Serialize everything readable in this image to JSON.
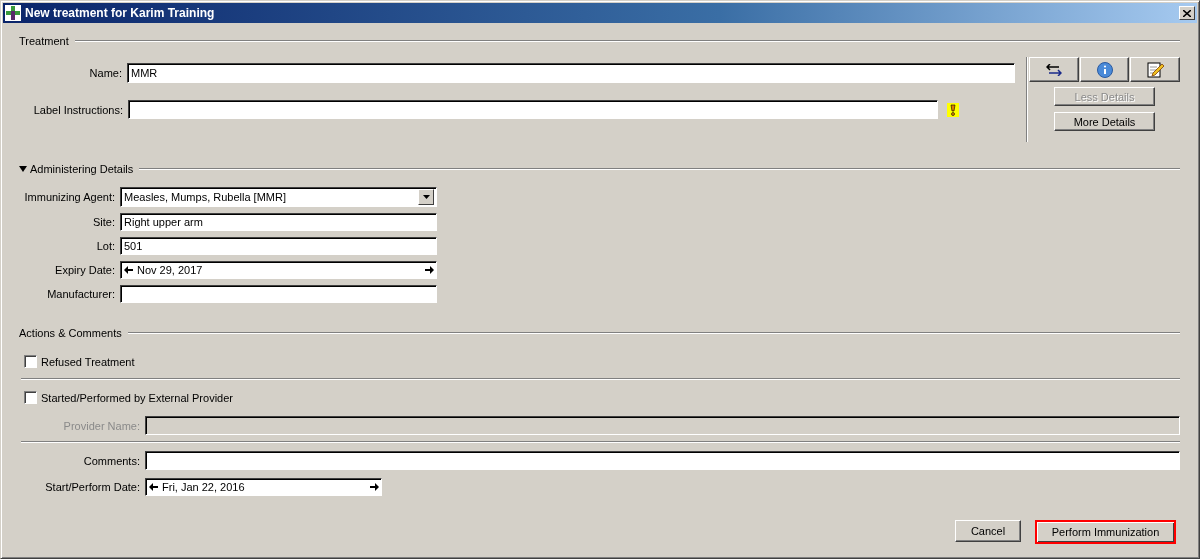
{
  "window": {
    "title": "New treatment for Karim Training"
  },
  "treatment": {
    "heading": "Treatment",
    "name": {
      "label": "Name:",
      "value": "MMR"
    },
    "label_instructions": {
      "label": "Label Instructions:",
      "hint": true
    }
  },
  "tool_buttons": [
    {
      "kind": "swap"
    },
    {
      "kind": "info"
    },
    {
      "kind": "edit"
    }
  ],
  "detail_buttons": [
    {
      "label": "Less Details",
      "disabled": true
    },
    {
      "label": "More Details",
      "disabled": false
    }
  ],
  "administering": {
    "heading": "Administering Details",
    "expanded": true,
    "fields": [
      {
        "kind": "dropdown",
        "label": "Immunizing Agent:",
        "value": "Measles, Mumps, Rubella [MMR]"
      },
      {
        "kind": "text",
        "label": "Site:",
        "value": "Right upper arm"
      },
      {
        "kind": "text",
        "label": "Lot:",
        "value": "501"
      },
      {
        "kind": "date",
        "label": "Expiry Date:",
        "value": "Nov 29, 2017"
      },
      {
        "kind": "text",
        "label": "Manufacturer:"
      }
    ]
  },
  "actions": {
    "heading": "Actions & Comments",
    "refused": {
      "label": "Refused Treatment",
      "checked": false
    },
    "external": {
      "label": "Started/Performed by External Provider",
      "checked": false
    },
    "provider_name": {
      "label": "Provider Name:",
      "disabled": true
    },
    "comments": {
      "label": "Comments:"
    },
    "start_date": {
      "label": "Start/Perform Date:",
      "value": "Fri, Jan 22, 2016"
    }
  },
  "buttons": [
    {
      "label": "Cancel",
      "highlighted": false
    },
    {
      "label": "Perform Immunization",
      "highlighted": true
    }
  ]
}
